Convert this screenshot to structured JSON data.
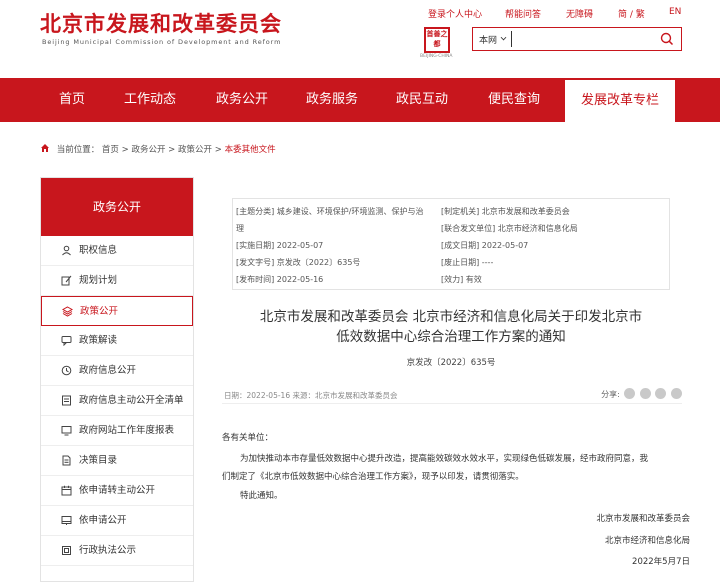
{
  "header": {
    "logo_cn": "北京市发展和改革委员会",
    "logo_en": "Beijing Municipal Commission of Development and Reform",
    "links": [
      "登录个人中心",
      "帮能问答",
      "无障碍",
      "简 / 繁",
      "EN"
    ],
    "seal_text": "首善之都",
    "seal_caption": "BEIJING·CHINA",
    "search_scope": "本网",
    "search_placeholder": ""
  },
  "nav": [
    "首页",
    "工作动态",
    "政务公开",
    "政务服务",
    "政民互动",
    "便民查询",
    "发展改革专栏"
  ],
  "nav_active_index": 6,
  "breadcrumb": {
    "prefix": "当前位置：",
    "items": [
      "首页",
      "政务公开",
      "政策公开"
    ],
    "current": "本委其他文件",
    "sep": " > "
  },
  "sidebar": {
    "title": "政务公开",
    "items": [
      {
        "label": "职权信息",
        "icon": "person-icon"
      },
      {
        "label": "规划计划",
        "icon": "edit-icon"
      },
      {
        "label": "政策公开",
        "icon": "layers-icon"
      },
      {
        "label": "政策解读",
        "icon": "chat-icon"
      },
      {
        "label": "政府信息公开",
        "icon": "clock-icon"
      },
      {
        "label": "政府信息主动公开全清单",
        "icon": "list-icon"
      },
      {
        "label": "政府网站工作年度报表",
        "icon": "monitor-icon"
      },
      {
        "label": "决策目录",
        "icon": "document-icon"
      },
      {
        "label": "依申请转主动公开",
        "icon": "calendar-icon"
      },
      {
        "label": "依申请公开",
        "icon": "screen-icon"
      },
      {
        "label": "行政执法公示",
        "icon": "box-icon"
      }
    ],
    "active_index": 2
  },
  "info": {
    "rows": [
      {
        "l": "[主题分类] 城乡建设、环境保护/环境监测、保护与治",
        "r": "[制定机关] 北京市发展和改革委员会"
      },
      {
        "l": "理",
        "r": "[联合发文单位] 北京市经济和信息化局"
      },
      {
        "l": "[实施日期] 2022-05-07",
        "r": "[成文日期] 2022-05-07"
      },
      {
        "l": "[发文字号] 京发改〔2022〕635号",
        "r": "[废止日期] ----"
      },
      {
        "l": "[发布时间] 2022-05-16",
        "r": "[效力] 有效"
      }
    ]
  },
  "article": {
    "title_line1": "北京市发展和改革委员会 北京市经济和信息化局关于印发北京市",
    "title_line2": "低效数据中心综合治理工作方案的通知",
    "doc_no": "京发改〔2022〕635号",
    "meta": "日期：2022-05-16    来源：北京市发展和改革委员会",
    "share_label": "分享:",
    "salutation": "各有关单位：",
    "para1_line1": "为加快推动本市存量低效数据中心提升改造，提高能效碳效水效水平，实现绿色低碳发展，经市政府同意，我",
    "para1_line2": "们制定了《北京市低效数据中心综合治理工作方案》，现予以印发，请贯彻落实。",
    "closing": "特此通知。",
    "sign1": "北京市发展和改革委员会",
    "sign2": "北京市经济和信息化局",
    "date": "2022年5月7日"
  },
  "colors": {
    "accent": "#c8161d"
  }
}
